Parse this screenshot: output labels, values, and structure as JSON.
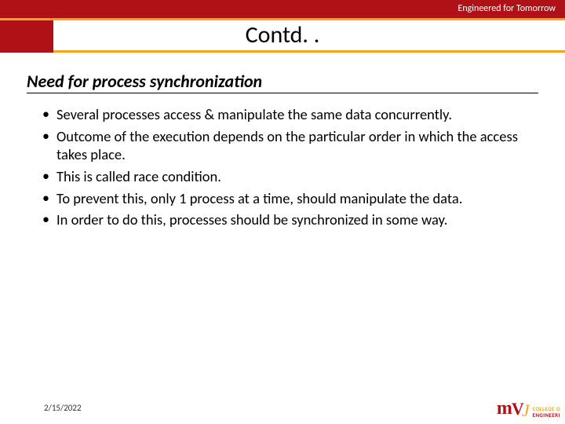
{
  "header": {
    "tagline": "Engineered for Tomorrow",
    "title": "Contd. ."
  },
  "subtitle": "Need for process synchronization",
  "bullets": [
    "Several processes access & manipulate the same data concurrently.",
    "Outcome of the execution depends on the particular order in which the access takes place.",
    "This is called race condition.",
    "To prevent this, only 1 process at a time, should manipulate the data.",
    "In order to do this, processes should be synchronized in some way."
  ],
  "footer": {
    "date": "2/15/2022",
    "logo_mark": {
      "m": "m",
      "v": "V",
      "j": "J"
    },
    "logo_text_line1": "COLLEGE O",
    "logo_text_line2": "ENGINEERI"
  }
}
